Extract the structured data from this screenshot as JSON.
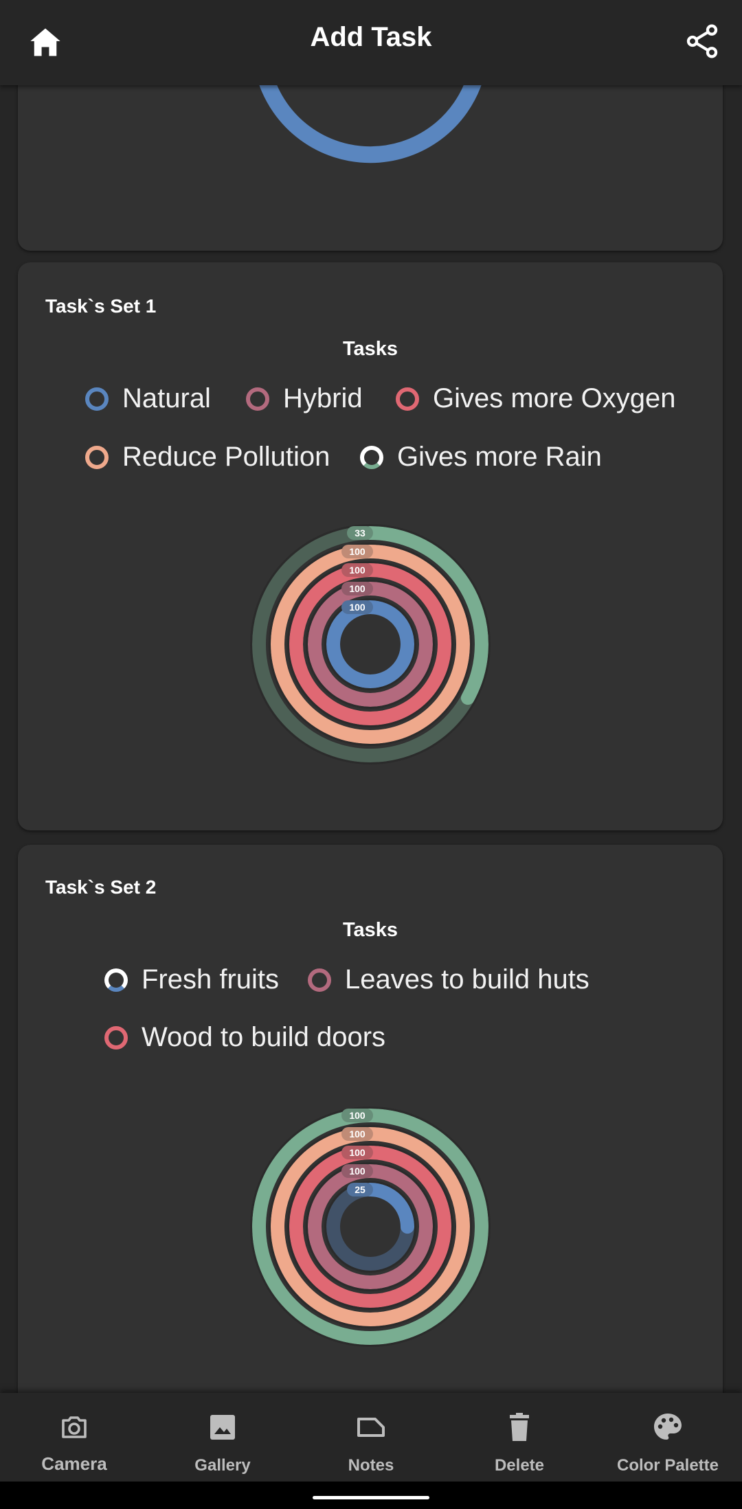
{
  "app_bar": {
    "title": "Add Task",
    "home_icon": "home-icon",
    "share_icon": "share-icon"
  },
  "colors": {
    "background": "#262626",
    "card": "#323232",
    "blue": "#5a86bf",
    "mauve": "#b36a7e",
    "red": "#e06873",
    "peach": "#efa98c",
    "green": "#79ad91"
  },
  "card1": {
    "title": "Task`s Set 1",
    "chart_data": {
      "type": "radialBar",
      "title": "Tasks",
      "series": [
        {
          "name": "Natural",
          "value": 100,
          "color": "#5a86bf"
        },
        {
          "name": "Hybrid",
          "value": 100,
          "color": "#b36a7e"
        },
        {
          "name": "Gives more Oxygen",
          "value": 100,
          "color": "#e06873"
        },
        {
          "name": "Reduce Pollution",
          "value": 100,
          "color": "#efa98c"
        },
        {
          "name": "Gives more Rain",
          "value": 33,
          "color": "#79ad91"
        }
      ],
      "max": 100
    }
  },
  "card2": {
    "title": "Task`s Set 2",
    "chart_data": {
      "type": "radialBar",
      "title": "Tasks",
      "legend": [
        {
          "name": "Fresh fruits",
          "color": "#5a86bf"
        },
        {
          "name": "Leaves to build huts",
          "color": "#b36a7e"
        },
        {
          "name": "Wood to build doors",
          "color": "#e06873"
        }
      ],
      "series": [
        {
          "value": 25,
          "color": "#5a86bf"
        },
        {
          "value": 100,
          "color": "#b36a7e"
        },
        {
          "value": 100,
          "color": "#e06873"
        },
        {
          "value": 100,
          "color": "#efa98c"
        },
        {
          "value": 100,
          "color": "#79ad91"
        }
      ],
      "max": 100
    }
  },
  "bottom_nav": [
    {
      "label": "Camera",
      "icon": "camera-icon"
    },
    {
      "label": "Gallery",
      "icon": "gallery-icon"
    },
    {
      "label": "Notes",
      "icon": "notes-icon"
    },
    {
      "label": "Delete",
      "icon": "delete-icon"
    },
    {
      "label": "Color Palette",
      "icon": "palette-icon"
    }
  ]
}
